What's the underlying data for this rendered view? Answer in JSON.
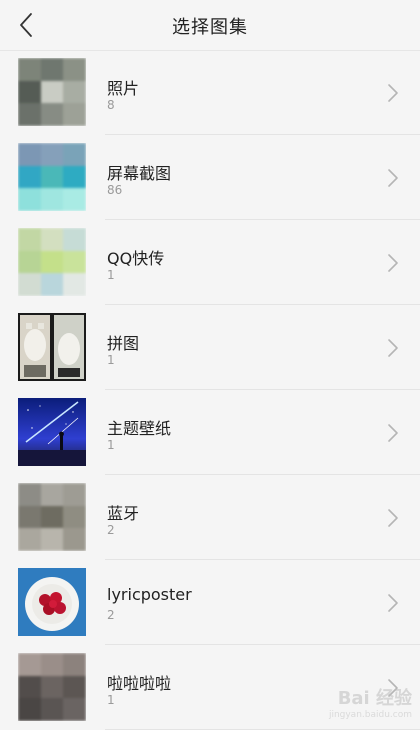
{
  "header": {
    "title": "选择图集"
  },
  "albums": [
    {
      "name": "照片",
      "count": "8"
    },
    {
      "name": "屏幕截图",
      "count": "86"
    },
    {
      "name": "QQ快传",
      "count": "1"
    },
    {
      "name": "拼图",
      "count": "1"
    },
    {
      "name": "主题壁纸",
      "count": "1"
    },
    {
      "name": "蓝牙",
      "count": "2"
    },
    {
      "name": "lyricposter",
      "count": "2"
    },
    {
      "name": "啦啦啦啦",
      "count": "1"
    }
  ],
  "colors": {
    "background": "#f5f5f5",
    "text_primary": "#222222",
    "text_secondary": "#9a9a9a",
    "chevron": "#b5b5b5"
  },
  "icons": {
    "back": "chevron-left-icon",
    "row_arrow": "chevron-right-icon"
  },
  "watermark": {
    "text": "Bai 经验",
    "subtext": "jingyan.baidu.com"
  }
}
